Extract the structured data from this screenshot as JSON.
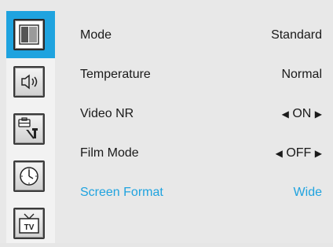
{
  "sidebar": {
    "items": [
      {
        "icon": "picture-icon",
        "active": true
      },
      {
        "icon": "speaker-icon",
        "active": false
      },
      {
        "icon": "toolbox-settings-icon",
        "active": false
      },
      {
        "icon": "clock-icon",
        "active": false
      },
      {
        "icon": "tv-icon",
        "active": false
      }
    ],
    "tv_icon_text": "TV"
  },
  "menu": {
    "rows": [
      {
        "label": "Mode",
        "value": "Standard"
      },
      {
        "label": "Temperature",
        "value": "Normal"
      },
      {
        "label": "Video NR",
        "left_arrow": "◀",
        "value": "ON",
        "right_arrow": "▶"
      },
      {
        "label": "Film Mode",
        "left_arrow": "◀",
        "value": "OFF",
        "right_arrow": "▶"
      },
      {
        "label": "Screen Format",
        "value": "Wide"
      }
    ]
  },
  "colors": {
    "accent": "#1fa3df",
    "background": "#e8e8e8",
    "sidebar_background": "#f2f2f2",
    "text": "#1a1a1a"
  }
}
